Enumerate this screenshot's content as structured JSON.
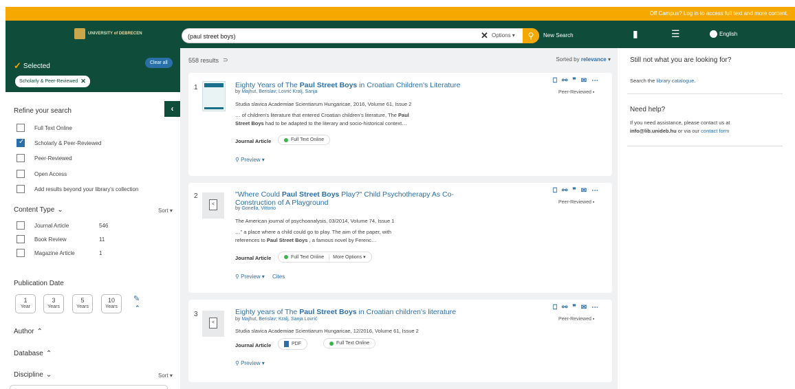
{
  "topbar": {
    "message": "Off Campus? Log in to access full text and more content."
  },
  "header": {
    "logo_text": "UNIVERSITY of DEBRECEN",
    "search_value": "(paul street boys)",
    "options_label": "Options",
    "new_search_label": "New Search",
    "language_label": "English"
  },
  "selected": {
    "title": "Selected",
    "clear_all": "Clear all",
    "chip": "Scholarly & Peer-Reviewed"
  },
  "refine": {
    "title": "Refine your search",
    "filters": [
      {
        "label": "Full Text Online",
        "checked": false
      },
      {
        "label": "Scholarly & Peer-Reviewed",
        "checked": true
      },
      {
        "label": "Peer-Reviewed",
        "checked": false
      },
      {
        "label": "Open Access",
        "checked": false
      },
      {
        "label": "Add results beyond your library's collection",
        "checked": false
      }
    ]
  },
  "content_type": {
    "title": "Content Type",
    "sort_label": "Sort",
    "items": [
      {
        "label": "Journal Article",
        "count": "546"
      },
      {
        "label": "Book Review",
        "count": "11"
      },
      {
        "label": "Magazine Article",
        "count": "1"
      }
    ]
  },
  "pub_date": {
    "title": "Publication Date",
    "buttons": [
      {
        "n": "1",
        "unit": "Year"
      },
      {
        "n": "3",
        "unit": "Years"
      },
      {
        "n": "5",
        "unit": "Years"
      },
      {
        "n": "10",
        "unit": "Years"
      }
    ]
  },
  "facets": {
    "author": "Author",
    "database": "Database",
    "discipline": "Discipline",
    "sort_label": "Sort"
  },
  "results": {
    "count": "558 results",
    "sorted_by": "Sorted by",
    "sort_value": "relevance",
    "items": [
      {
        "num": "1",
        "title_pre": "Eighty Years of The ",
        "title_bold": "Paul Street Boys",
        "title_post": " in Croatian Children's Literature",
        "authors": "Majhut, Berislav; Lovrić Kralj, Sanja",
        "pub": "Studia slavica Academiae Scientiarum Hungaricae, 2016, Volume 61, Issue 2",
        "snip1": "… of children's literature that entered Croatian children's literature, The ",
        "snip1_bold": "Paul",
        "snip2_bold": "Street Boys",
        "snip2": " had to be adapted to the literary and socio-historical context…",
        "type": "Journal Article",
        "pill1": "Full Text Online",
        "preview": "Preview",
        "peer": "Peer-Reviewed"
      },
      {
        "num": "2",
        "title_pre": "\"Where Could ",
        "title_bold": "Paul Street Boys",
        "title_post": " Play?\" Child Psychotherapy As Co-Construction of A Playground",
        "authors": "Gonella, Vittorio",
        "pub": "The American journal of psychoanalysis, 03/2014, Volume 74, Issue 1",
        "snip1": "…\" a place where a child could go to play. The aim of the paper, with",
        "snip2_pre": "references to ",
        "snip2_bold": "Paul Street Boys",
        "snip2": " , a famous novel by Ferenc…",
        "type": "Journal Article",
        "pill1": "Full Text Online",
        "pill2": "More Options",
        "preview": "Preview",
        "cites": "Cites",
        "peer": "Peer-Reviewed"
      },
      {
        "num": "3",
        "title_pre": "Eighty years of The ",
        "title_bold": "Paul Street Boys",
        "title_post": " in Croatian children's literature",
        "authors": "Majhut, Berislav; Kralj, Sanja Lovrić",
        "pub": "Studia slavica Academiae Scientiarum Hungaricae, 12/2016, Volume 61, Issue 2",
        "type": "Journal Article",
        "pill_pdf": "PDF",
        "pill1": "Full Text Online",
        "preview": "Preview",
        "peer": "Peer-Reviewed"
      }
    ]
  },
  "right": {
    "q_title": "Still not what you are looking for?",
    "search_pre": "Search the ",
    "search_link": "library catalogue",
    "search_post": ".",
    "help_title": "Need help?",
    "help_text": "If you need assistance, please contact us at",
    "help_email": "info@lib.unideb.hu",
    "help_or": " or via our ",
    "help_link": "contact form"
  },
  "colors": {
    "brand": "#0f4c3a",
    "accent": "#f6a800",
    "link": "#2b6fa8"
  }
}
